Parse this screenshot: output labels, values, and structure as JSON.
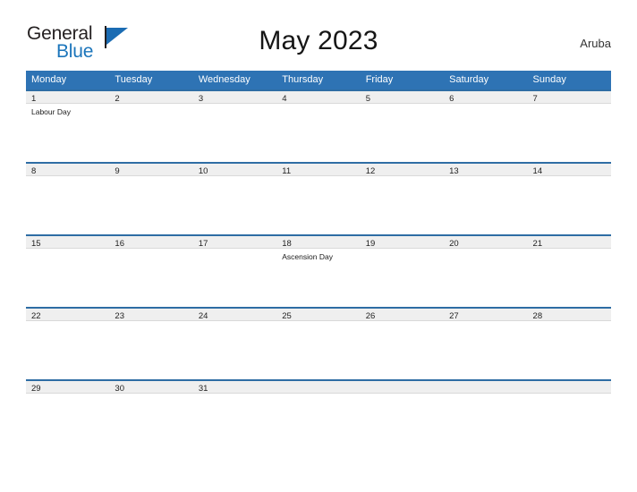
{
  "brand": {
    "line1": "General",
    "line2": "Blue",
    "flag_icon": "flag-triangle-icon",
    "colors": {
      "text_dark": "#231f20",
      "blue": "#1b75bb"
    }
  },
  "header": {
    "title": "May 2023",
    "locale": "Aruba"
  },
  "calendar": {
    "weekday_headers": [
      "Monday",
      "Tuesday",
      "Wednesday",
      "Thursday",
      "Friday",
      "Saturday",
      "Sunday"
    ],
    "colors": {
      "header_blue": "#2e73b4",
      "date_band": "#efefef",
      "date_band_top_border": "#2e6da4"
    },
    "weeks": [
      {
        "days": [
          {
            "number": "1",
            "events": [
              "Labour Day"
            ]
          },
          {
            "number": "2",
            "events": []
          },
          {
            "number": "3",
            "events": []
          },
          {
            "number": "4",
            "events": []
          },
          {
            "number": "5",
            "events": []
          },
          {
            "number": "6",
            "events": []
          },
          {
            "number": "7",
            "events": []
          }
        ]
      },
      {
        "days": [
          {
            "number": "8",
            "events": []
          },
          {
            "number": "9",
            "events": []
          },
          {
            "number": "10",
            "events": []
          },
          {
            "number": "11",
            "events": []
          },
          {
            "number": "12",
            "events": []
          },
          {
            "number": "13",
            "events": []
          },
          {
            "number": "14",
            "events": []
          }
        ]
      },
      {
        "days": [
          {
            "number": "15",
            "events": []
          },
          {
            "number": "16",
            "events": []
          },
          {
            "number": "17",
            "events": []
          },
          {
            "number": "18",
            "events": [
              "Ascension Day"
            ]
          },
          {
            "number": "19",
            "events": []
          },
          {
            "number": "20",
            "events": []
          },
          {
            "number": "21",
            "events": []
          }
        ]
      },
      {
        "days": [
          {
            "number": "22",
            "events": []
          },
          {
            "number": "23",
            "events": []
          },
          {
            "number": "24",
            "events": []
          },
          {
            "number": "25",
            "events": []
          },
          {
            "number": "26",
            "events": []
          },
          {
            "number": "27",
            "events": []
          },
          {
            "number": "28",
            "events": []
          }
        ]
      },
      {
        "days": [
          {
            "number": "29",
            "events": []
          },
          {
            "number": "30",
            "events": []
          },
          {
            "number": "31",
            "events": []
          },
          {
            "number": "",
            "events": []
          },
          {
            "number": "",
            "events": []
          },
          {
            "number": "",
            "events": []
          },
          {
            "number": "",
            "events": []
          }
        ]
      }
    ]
  }
}
